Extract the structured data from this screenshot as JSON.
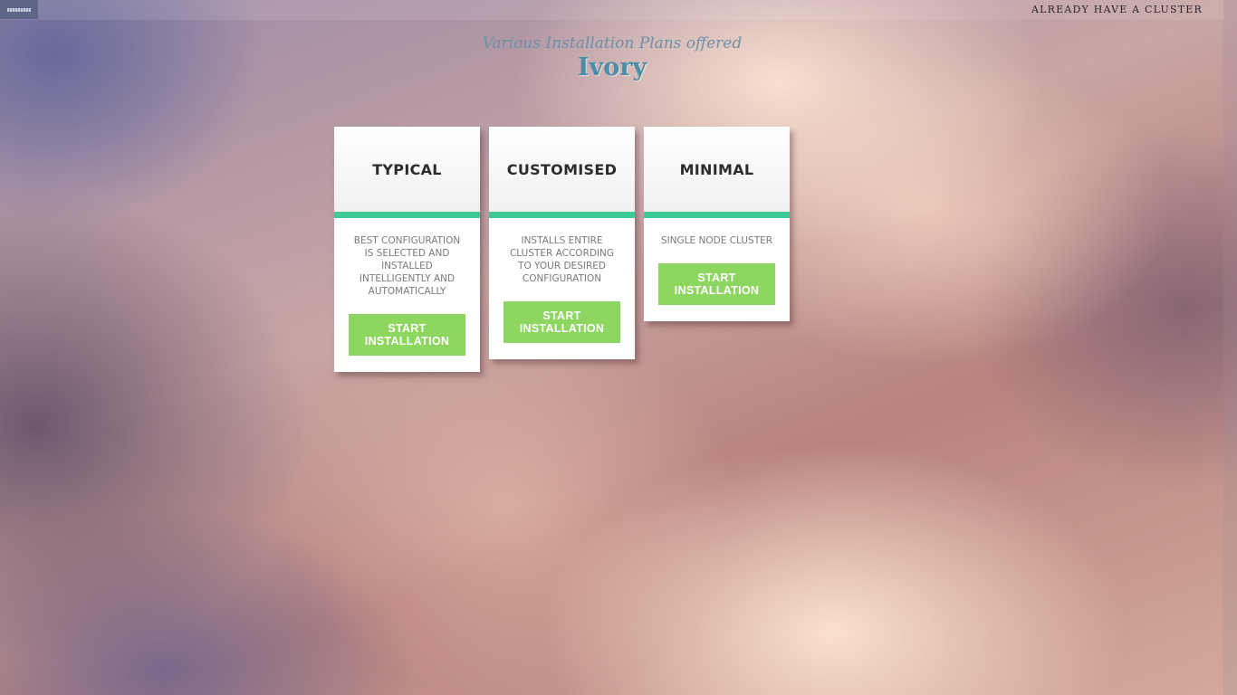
{
  "topbar": {
    "logo_icon": "app-logo",
    "cluster_link": "ALREADY HAVE A CLUSTER"
  },
  "header": {
    "subtitle": "Various Installation Plans offered",
    "title": "Ivory"
  },
  "plans": [
    {
      "title": "TYPICAL",
      "description": "BEST CONFIGURATION IS SELECTED AND INSTALLED INTELLIGENTLY AND AUTOMATICALLY",
      "button_label": "START INSTALLATION"
    },
    {
      "title": "CUSTOMISED",
      "description": "INSTALLS ENTIRE CLUSTER ACCORDING TO YOUR DESIRED CONFIGURATION",
      "button_label": "START INSTALLATION"
    },
    {
      "title": "MINIMAL",
      "description": "SINGLE NODE CLUSTER",
      "button_label": "START INSTALLATION"
    }
  ],
  "colors": {
    "accent_bar": "#3ccb97",
    "button_bg": "#8dd660",
    "title_color": "#4a8ea8",
    "subtitle_color": "#6e90a7"
  }
}
